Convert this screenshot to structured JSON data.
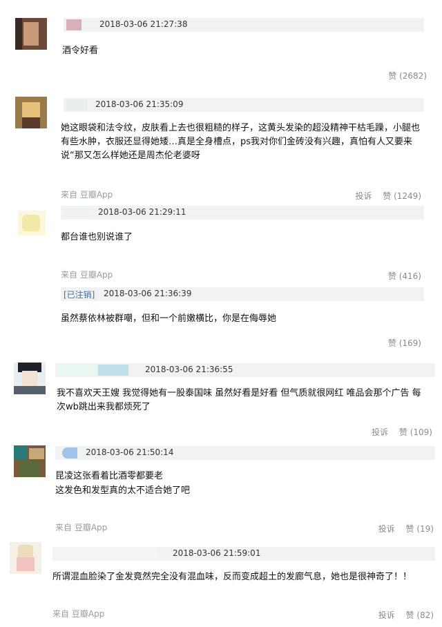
{
  "comments": [
    {
      "time": "2018-03-06 21:27:38",
      "text": "酒令好看",
      "like_label": "赞 (2682)"
    },
    {
      "time": "2018-03-06 21:35:09",
      "text": "她这眼袋和法令纹，皮肤看上去也很粗糙的样子，这黄头发染的超没精神干枯毛躁，小腿也有些水肿，衣服还显得她矮…真是全身槽点，ps我对你们金砖没有兴趣，真怕有人又要来说“那又怎么样她还是周杰伦老婆呀",
      "source": "来自 豆瓣App",
      "report_label": "投诉",
      "like_label": "赞 (1249)"
    },
    {
      "time": "2018-03-06 21:29:11",
      "text": "都台谁也别说谁了",
      "source": "来自 豆瓣App",
      "like_label": "赞 (416)",
      "reply": {
        "tag": "[已注销]",
        "time": "2018-03-06 21:36:39",
        "text": "虽然蔡依林被群嘲，但和一个前嫩横比，你是在侮辱她",
        "like_label": "赞 (169)"
      }
    },
    {
      "time": "2018-03-06 21:36:55",
      "text": "我不喜欢天王嫂 我觉得她有一股泰国味 虽然好看是好看 但气质就很网红 唯品会那个广告 每次wb跳出来我都烦死了",
      "report_label": "投诉",
      "like_label": "赞 (109)"
    },
    {
      "time": "2018-03-06 21:50:14",
      "text_line1": "昆凌这张看着比酒零都要老",
      "text_line2": "这发色和发型真的太不适合她了吧",
      "source": "来自 豆瓣App",
      "report_label": "投诉",
      "like_label": "赞 (19)"
    },
    {
      "time": "2018-03-06 21:59:01",
      "text": "所谓混血脸染了金发竟然完全没有混血味，反而变成超土的发廊气息，她也是很神奇了！！",
      "source": "来自 豆瓣App",
      "report_label": "投诉",
      "like_label": "赞 (82)"
    }
  ],
  "colors": {
    "meta_bar": "#f0f3f1",
    "link_tag": "#3a6ea5",
    "muted": "#9a9a9a"
  }
}
